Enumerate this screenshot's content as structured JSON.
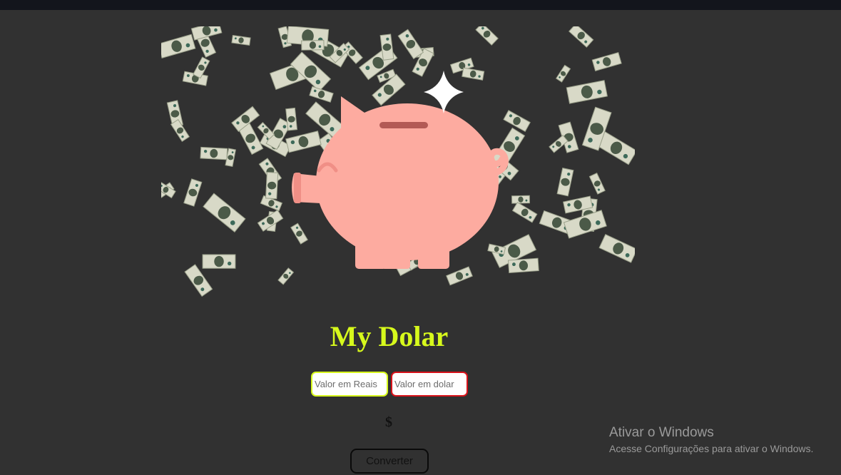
{
  "app": {
    "title": "My Dolar",
    "title_color": "#d7f91c"
  },
  "hero": {
    "icon": "piggy-bank-icon",
    "background": "flying-dollar-bills",
    "pig_color": "#fdaba0",
    "bill_color": "#d8d9c7"
  },
  "form": {
    "reais_placeholder": "Valor em Reais",
    "reais_border": "#d7f91c",
    "dolar_placeholder": "Valor em dolar",
    "dolar_border": "#d8121a",
    "result_symbol": "$",
    "convert_label": "Converter"
  },
  "watermark": {
    "title": "Ativar o Windows",
    "subtitle": "Acesse Configurações para ativar o Windows."
  }
}
